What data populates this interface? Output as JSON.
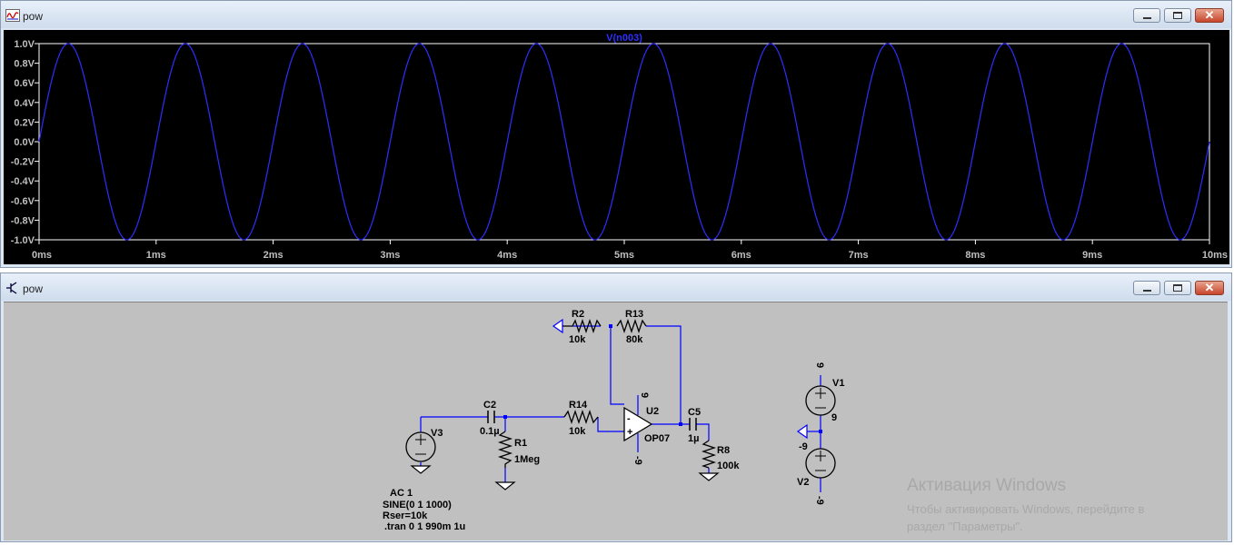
{
  "waveform_window": {
    "title": "pow",
    "icon": "waveform-viewer-icon",
    "trace_label": "V(n003)",
    "controls": {
      "minimize": "minimize-icon",
      "maximize": "maximize-icon",
      "close": "✕"
    }
  },
  "chart_data": {
    "type": "line",
    "title": "",
    "series": [
      {
        "name": "V(n003)",
        "color": "#2e2eff",
        "function": "sine",
        "amplitude_V": 1.0,
        "offset_V": 0.0,
        "frequency_Hz": 1000,
        "x_start_ms": 0,
        "x_end_ms": 10
      }
    ],
    "x_ticks": [
      "0ms",
      "1ms",
      "2ms",
      "3ms",
      "4ms",
      "5ms",
      "6ms",
      "7ms",
      "8ms",
      "9ms",
      "10ms"
    ],
    "y_ticks": [
      "1.0V",
      "0.8V",
      "0.6V",
      "0.4V",
      "0.2V",
      "0.0V",
      "-0.2V",
      "-0.4V",
      "-0.6V",
      "-0.8V",
      "-1.0V"
    ],
    "xlim": [
      0,
      10
    ],
    "ylim": [
      -1.0,
      1.0
    ],
    "grid": false,
    "background": "#000000",
    "axis_color": "#ffffff",
    "label_color": "#bfbfbf"
  },
  "schematic_window": {
    "title": "pow",
    "icon": "schematic-icon",
    "controls": {
      "minimize": "minimize-icon",
      "maximize": "maximize-icon",
      "close": "✕"
    },
    "wire_color": "#0000ff",
    "labels": {
      "R2": "R2",
      "R2v": "10k",
      "R13": "R13",
      "R13v": "80k",
      "C2": "C2",
      "C2v": "0.1µ",
      "R14": "R14",
      "R14v": "10k",
      "R1": "R1",
      "R1v": "1Meg",
      "U2": "U2",
      "U2v": "OP07",
      "C5": "C5",
      "C5v": "1µ",
      "R8": "R8",
      "R8v": "100k",
      "V3": "V3",
      "V1": "V1",
      "V1v": "9",
      "V2": "V2",
      "V2v": "-9",
      "net_pos": "9",
      "net_neg": "-9",
      "opamp_top": "9",
      "opamp_bot": "-9",
      "opamp_plus": "+",
      "opamp_minus": "-"
    },
    "spice": {
      "line1": "AC 1",
      "line2": "SINE(0 1 1000)",
      "line3": "Rser=10k",
      "line4": ".tran 0 1 990m 1u"
    }
  },
  "activation": {
    "title": "Активация Windows",
    "line1": "Чтобы активировать Windows, перейдите в",
    "line2": "раздел \"Параметры\"."
  }
}
